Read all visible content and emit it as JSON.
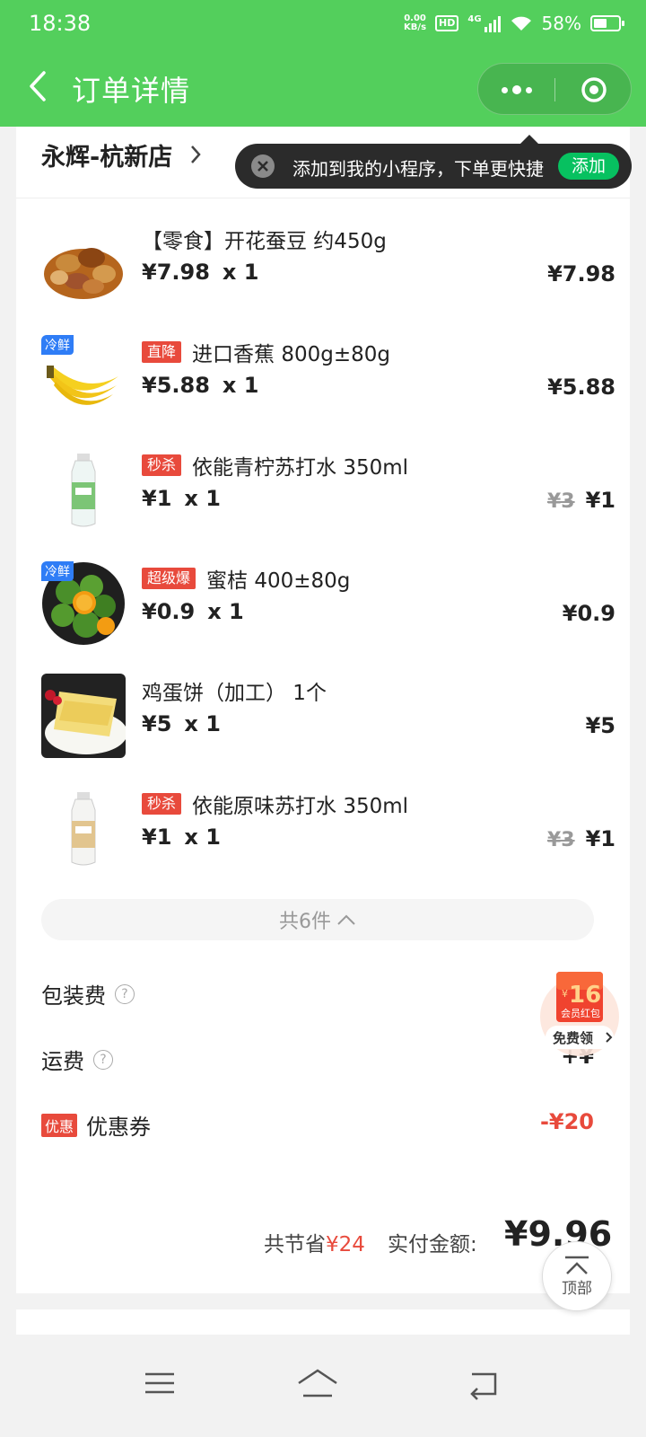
{
  "status_bar": {
    "time": "18:38",
    "network_speed_value": "0.00",
    "network_speed_unit": "KB/s",
    "hd_badge": "HD",
    "signal_type": "4G",
    "battery_percent": "58%"
  },
  "nav": {
    "title": "订单详情",
    "back_icon": "back-arrow-icon",
    "more_icon": "more-dots-icon",
    "close_icon": "target-close-icon"
  },
  "store": {
    "name": "永辉-杭新店",
    "chevron": "›"
  },
  "tooltip": {
    "text": "添加到我的小程序，下单更快捷",
    "add_label": "添加"
  },
  "items": [
    {
      "tag": "",
      "promo": "",
      "name": "【零食】开花蚕豆 约450g",
      "price": "¥7.98",
      "qty": "x  1",
      "orig": "",
      "total": "¥7.98"
    },
    {
      "tag": "冷鲜",
      "promo": "直降",
      "name": "进口香蕉 800g±80g",
      "price": "¥5.88",
      "qty": "x  1",
      "orig": "",
      "total": "¥5.88"
    },
    {
      "tag": "",
      "promo": "秒杀",
      "name": "依能青柠苏打水 350ml",
      "price": "¥1",
      "qty": "x  1",
      "orig": "¥3",
      "total": "¥1"
    },
    {
      "tag": "冷鲜",
      "promo": "超级爆",
      "name": "蜜桔 400±80g",
      "price": "¥0.9",
      "qty": "x  1",
      "orig": "",
      "total": "¥0.9"
    },
    {
      "tag": "",
      "promo": "",
      "name": "鸡蛋饼（加工） 1个",
      "price": "¥5",
      "qty": "x  1",
      "orig": "",
      "total": "¥5"
    },
    {
      "tag": "",
      "promo": "秒杀",
      "name": "依能原味苏打水 350ml",
      "price": "¥1",
      "qty": "x  1",
      "orig": "¥3",
      "total": "¥1"
    }
  ],
  "count_bar": {
    "label": "共6件"
  },
  "fees": {
    "packaging_label": "包装费",
    "packaging_value": "¥",
    "shipping_label": "运费",
    "shipping_value": "+¥",
    "coupon_badge": "优惠",
    "coupon_label": "优惠券",
    "coupon_value": "-¥20"
  },
  "summary": {
    "save_prefix": "共节省",
    "save_amount": "¥24",
    "pay_label": "实付金额:",
    "pay_amount": "¥9.96"
  },
  "promo_float": {
    "amount": "16",
    "label": "会员红包",
    "cta": "免费领"
  },
  "top_button": {
    "label": "顶部"
  },
  "colors": {
    "header_green": "#53cf5c",
    "promo_red": "#e84a3c",
    "cold_blue": "#2f7df6",
    "add_green": "#07c160"
  }
}
